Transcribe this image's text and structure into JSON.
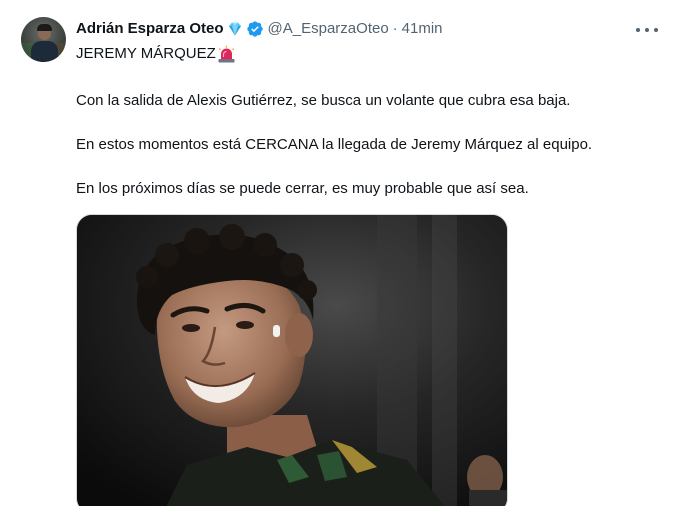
{
  "tweet": {
    "author": {
      "display_name": "Adrián Esparza Oteo",
      "name_emoji": "gem-icon",
      "verified": true,
      "handle": "@A_EsparzaOteo",
      "separator": "·",
      "time": "41min"
    },
    "menu_icon": "more-horizontal-icon",
    "text": {
      "headline": "JEREMY MÁRQUEZ",
      "headline_emoji": "siren-icon",
      "paragraph_1": "Con la salida de Alexis Gutiérrez, se busca un volante que cubra esa baja.",
      "paragraph_2": "En estos momentos está CERCANA la llegada de Jeremy Márquez al equipo.",
      "paragraph_3": "En los próximos días se puede cerrar, es muy probable que así sea."
    },
    "media": {
      "type": "photo",
      "description_icon": "player-photo"
    }
  },
  "colors": {
    "text_primary": "#0f1419",
    "text_secondary": "#536471",
    "verified_blue": "#1d9bf0",
    "border": "#cfd9de",
    "siren_red": "#e0245e"
  }
}
